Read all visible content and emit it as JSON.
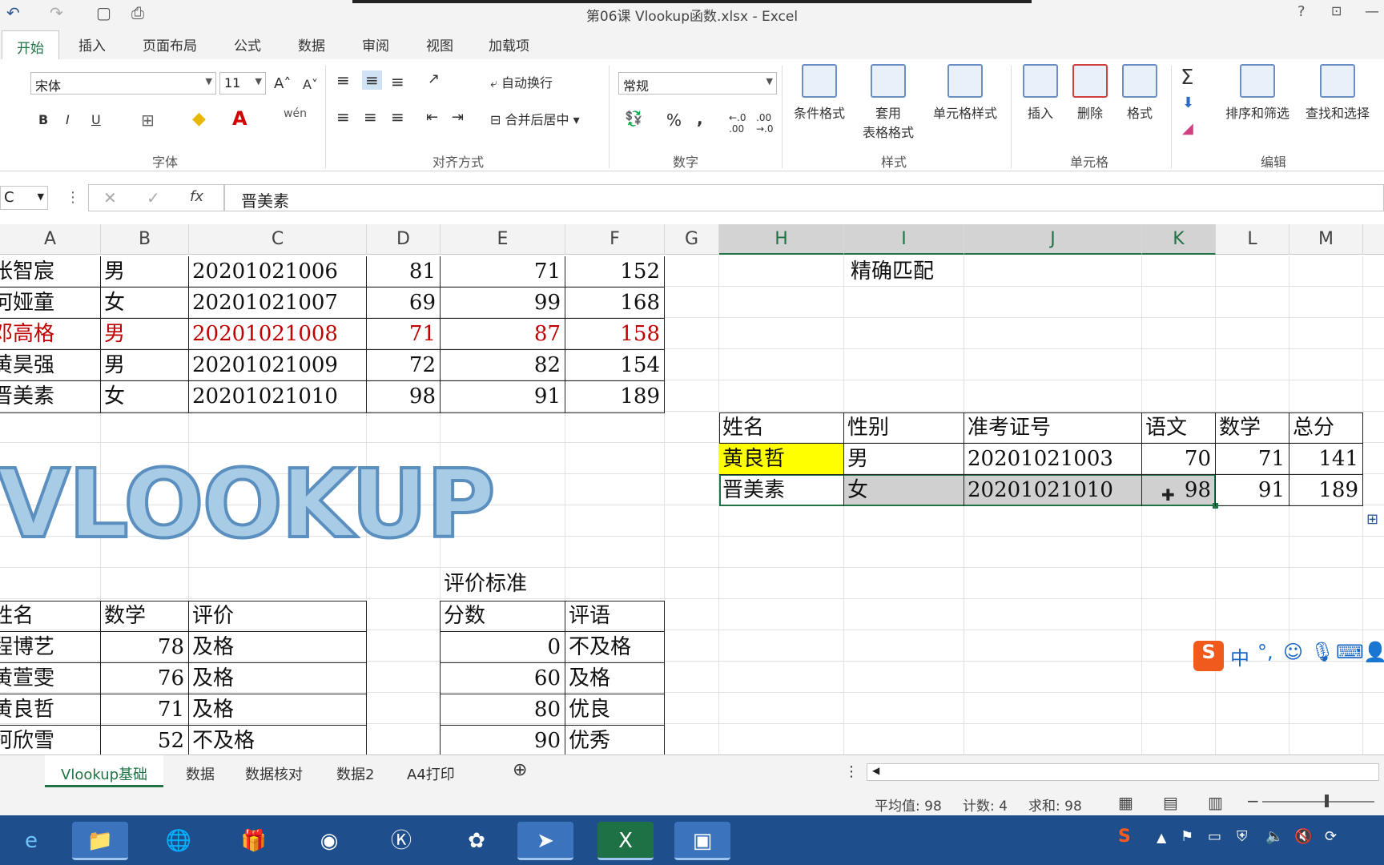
{
  "window": {
    "title": "第06课 Vlookup函数.xlsx - Excel",
    "help": "?"
  },
  "tabs": [
    "开始",
    "插入",
    "页面布局",
    "公式",
    "数据",
    "审阅",
    "视图",
    "加载项"
  ],
  "ribbon": {
    "font_name": "宋体",
    "font_size": "11",
    "wrap_text": "自动换行",
    "merge_center": "合并后居中",
    "number_format": "常规",
    "percent": "%",
    "comma": ",",
    "bold": "B",
    "italic": "I",
    "underline": "U",
    "cond_format": "条件格式",
    "table_format_1": "套用",
    "table_format_2": "表格格式",
    "cell_style": "单元格样式",
    "insert": "插入",
    "delete": "删除",
    "format": "格式",
    "sort_filter": "排序和筛选",
    "find_select": "查找和选择",
    "groups": {
      "font": "字体",
      "align": "对齐方式",
      "number": "数字",
      "styles": "样式",
      "cells": "单元格",
      "edit": "编辑"
    }
  },
  "formula_bar": {
    "name_box": "C",
    "value": "晋美素",
    "fx": "fx"
  },
  "columns": [
    "A",
    "B",
    "C",
    "D",
    "E",
    "F",
    "G",
    "H",
    "I",
    "J",
    "K",
    "L",
    "M"
  ],
  "left_table": [
    [
      "张智宸",
      "男",
      "20201021006",
      "81",
      "71",
      "152"
    ],
    [
      "何娅童",
      "女",
      "20201021007",
      "69",
      "99",
      "168"
    ],
    [
      "邓高格",
      "男",
      "20201021008",
      "71",
      "87",
      "158"
    ],
    [
      "黄昊强",
      "男",
      "20201021009",
      "72",
      "82",
      "154"
    ],
    [
      "晋美素",
      "女",
      "20201021010",
      "98",
      "91",
      "189"
    ]
  ],
  "exact_match_title": "精确匹配",
  "right_table": {
    "headers": [
      "姓名",
      "性别",
      "准考证号",
      "语文",
      "数学",
      "总分"
    ],
    "rows": [
      [
        "黄良哲",
        "男",
        "20201021003",
        "70",
        "71",
        "141"
      ],
      [
        "晋美素",
        "女",
        "20201021010",
        "98",
        "91",
        "189"
      ]
    ]
  },
  "art_text": "VLOOKUP",
  "eval_title": "评价标准",
  "score_table": {
    "headers": [
      "姓名",
      "数学",
      "评价"
    ],
    "rows": [
      [
        "程博艺",
        "78",
        "及格"
      ],
      [
        "黄萱雯",
        "76",
        "及格"
      ],
      [
        "黄良哲",
        "71",
        "及格"
      ],
      [
        "柯欣雪",
        "52",
        "不及格"
      ]
    ]
  },
  "criteria_table": {
    "headers": [
      "分数",
      "评语"
    ],
    "rows": [
      [
        "0",
        "不及格"
      ],
      [
        "60",
        "及格"
      ],
      [
        "80",
        "优良"
      ],
      [
        "90",
        "优秀"
      ]
    ]
  },
  "sheets": [
    "Vlookup基础",
    "数据",
    "数据核对",
    "数据2",
    "A4打印"
  ],
  "status": {
    "avg": "平均值: 98",
    "count": "计数: 4",
    "sum": "求和: 98"
  },
  "ime": {
    "mode": "中"
  },
  "colors": {
    "excel_green": "#217346",
    "highlight": "#ffff00",
    "red_row": "#c00000"
  }
}
